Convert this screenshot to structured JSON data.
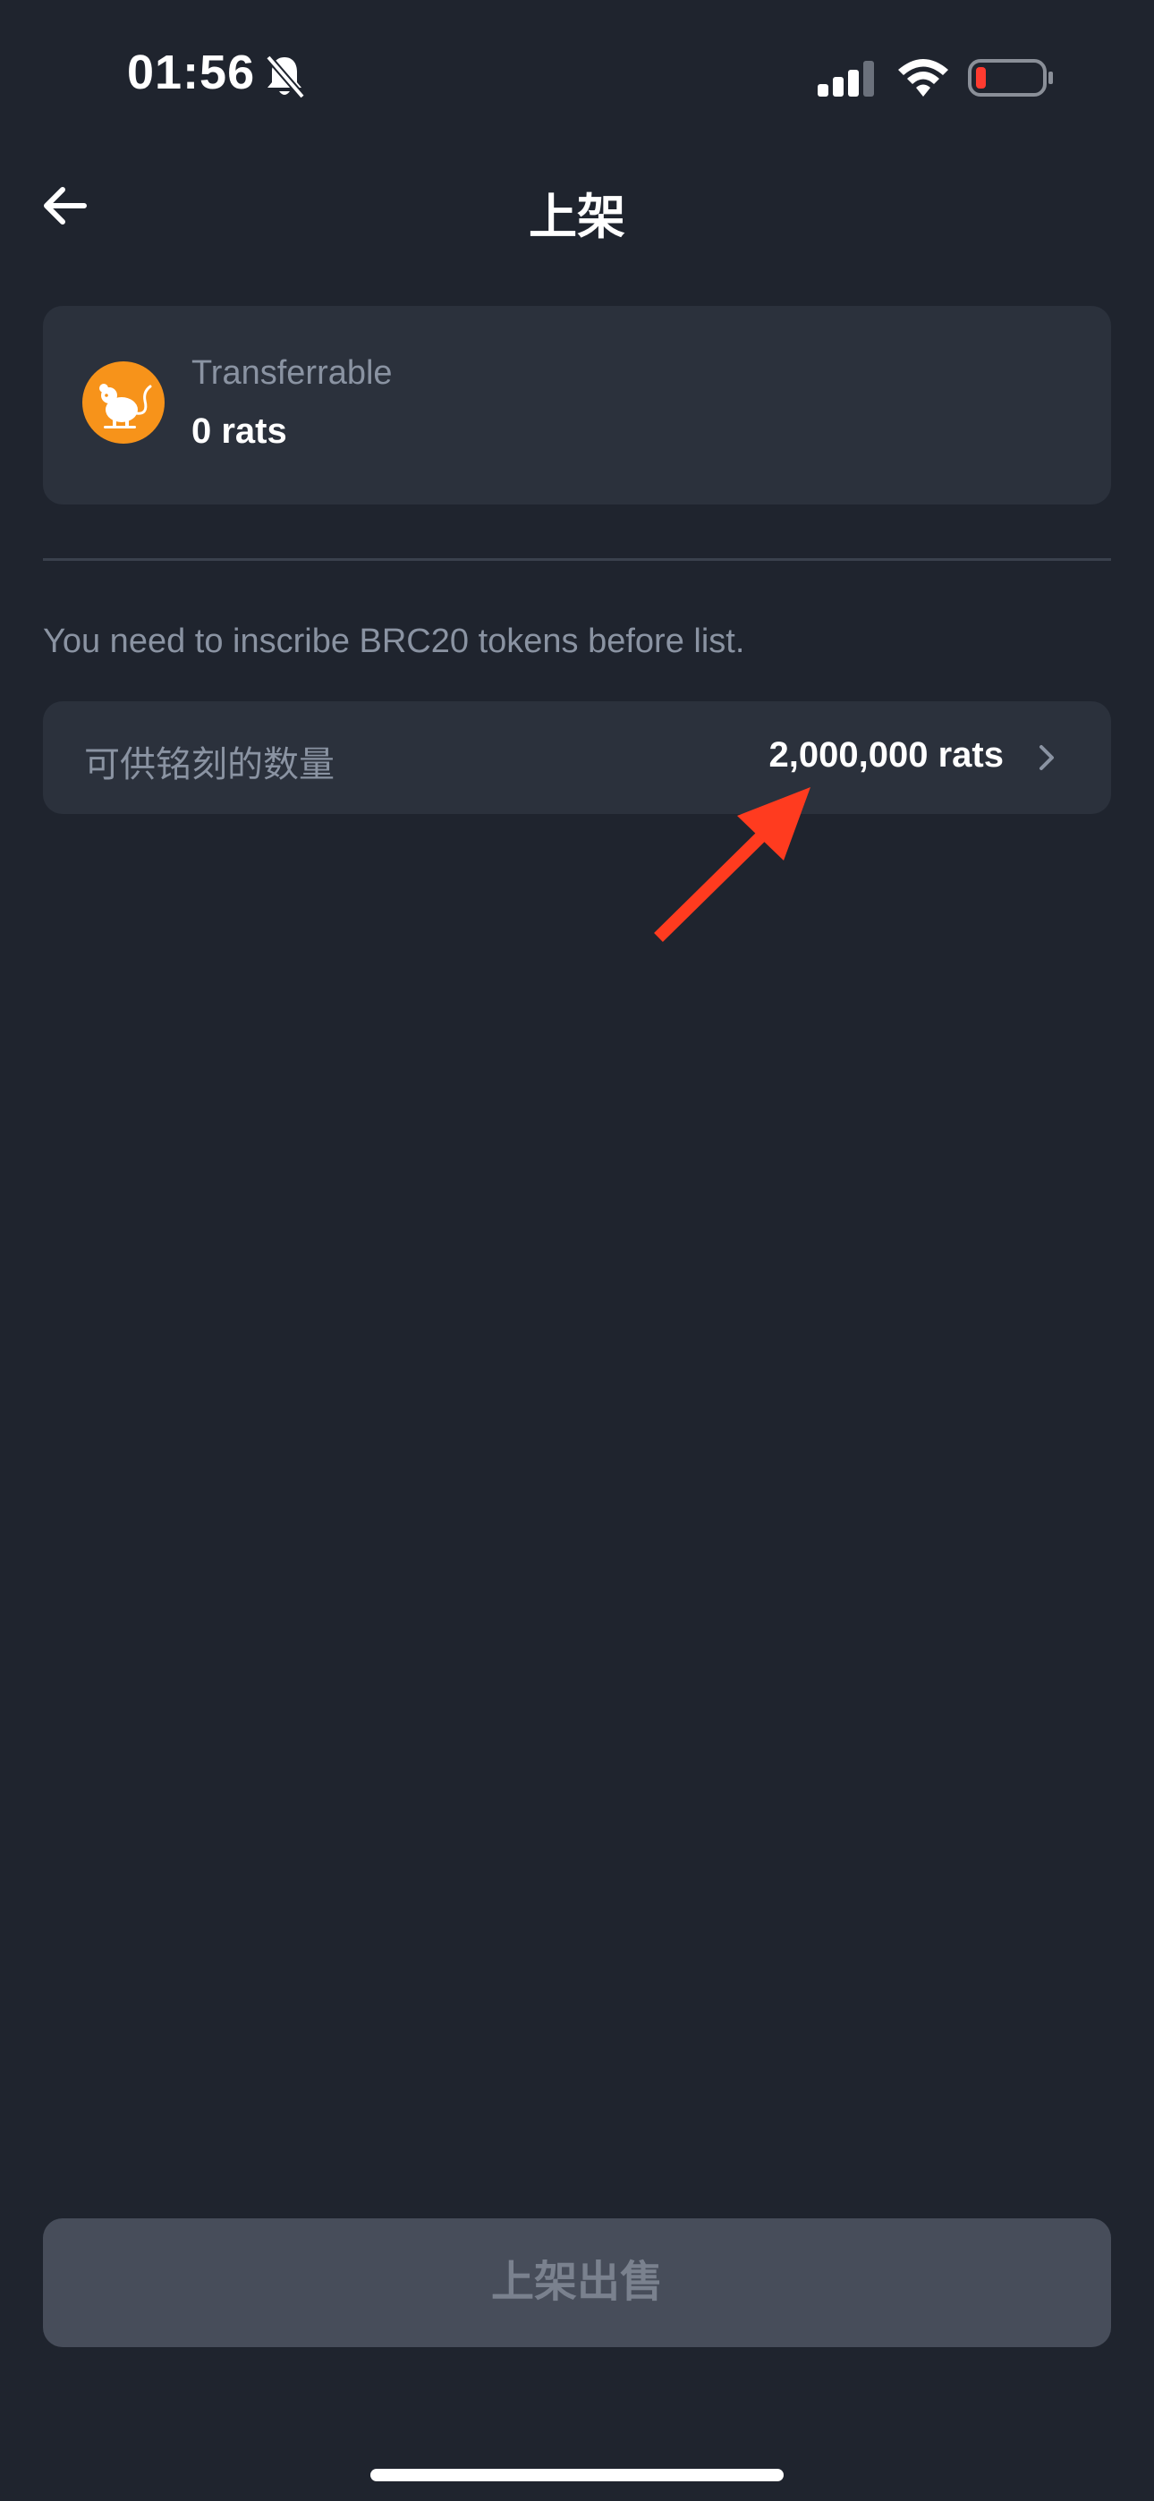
{
  "status_bar": {
    "time": "01:56",
    "icons": [
      "bell-slash-icon",
      "signal-icon",
      "wifi-icon",
      "battery-low-icon"
    ]
  },
  "header": {
    "title": "上架",
    "back_icon": "arrow-left-icon"
  },
  "token": {
    "label": "Transferrable",
    "balance": "0 rats",
    "logo_icon": "rat-icon",
    "logo_color": "#f7931a"
  },
  "notice": "You need to inscribe BRC20 tokens before list.",
  "inscribe": {
    "label": "可供铭刻的数量",
    "value": "2,000,000 rats"
  },
  "list_button": {
    "label": "上架出售"
  },
  "colors": {
    "background": "#1f242e",
    "card": "#2b313c",
    "muted_text": "#8a93a2",
    "annotation_arrow": "#ff3b1f"
  }
}
